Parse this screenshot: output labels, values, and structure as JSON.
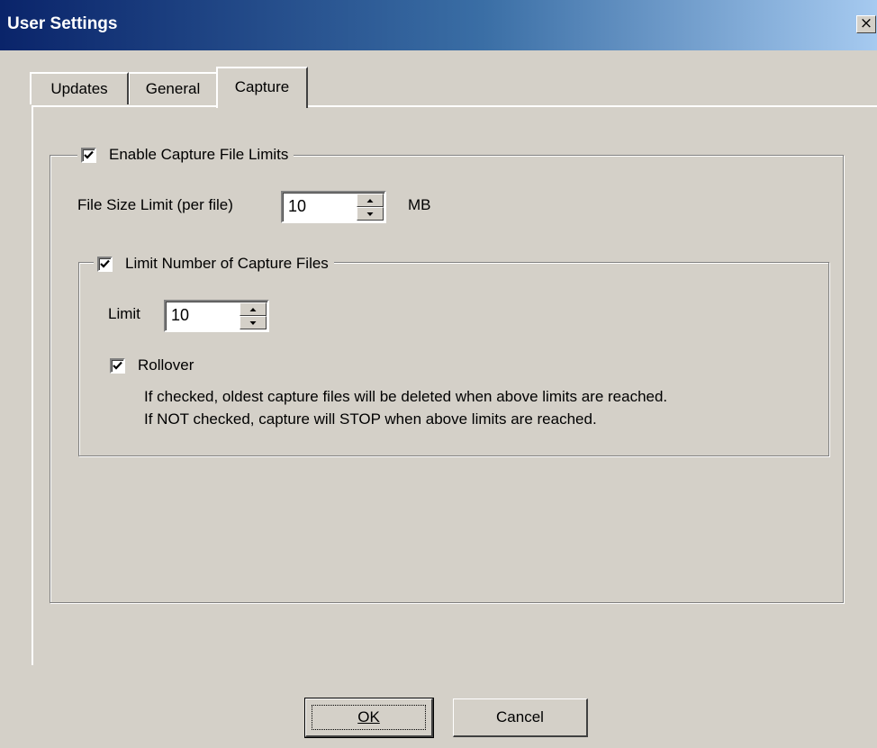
{
  "window": {
    "title": "User Settings",
    "close_glyph": "×"
  },
  "tabs": [
    {
      "label": "Updates",
      "selected": false
    },
    {
      "label": "General",
      "selected": false
    },
    {
      "label": "Capture",
      "selected": true
    }
  ],
  "capture": {
    "enable_limits": {
      "label": "Enable Capture File Limits",
      "checked": true
    },
    "file_size": {
      "label": "File Size Limit (per file)",
      "value": "10",
      "unit": "MB"
    },
    "limit_number": {
      "label": "Limit Number of Capture Files",
      "checked": true
    },
    "limit": {
      "label": "Limit",
      "value": "10"
    },
    "rollover": {
      "label": "Rollover",
      "checked": true,
      "help_line1": "If checked, oldest capture files will be deleted when above limits are reached.",
      "help_line2": "If NOT checked, capture will STOP when above limits are reached."
    }
  },
  "buttons": {
    "ok": {
      "label": "OK",
      "accelerator": "O"
    },
    "cancel": {
      "label": "Cancel",
      "accelerator": "C"
    }
  },
  "colors": {
    "face": "#d4d0c8",
    "title_start": "#0a246a",
    "title_end": "#a6caf0"
  }
}
